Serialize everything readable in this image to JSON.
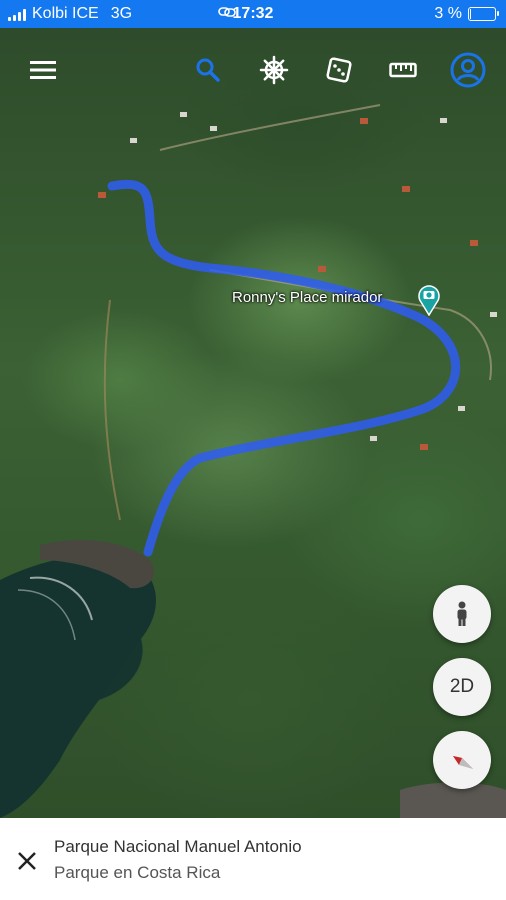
{
  "status_bar": {
    "carrier": "Kolbi ICE",
    "network": "3G",
    "time": "17:32",
    "battery": "3 %",
    "battery_level": 0.03
  },
  "toolbar": {
    "menu_icon": "hamburger-menu-icon",
    "search_icon": "search-icon",
    "voyager_icon": "ship-wheel-icon",
    "feeling_lucky_icon": "dice-icon",
    "measure_icon": "ruler-icon",
    "account_icon": "account-circle-icon"
  },
  "map": {
    "place_label": "Ronny's Place mirador",
    "place_icon": "camera-pin-icon",
    "path_color": "#2f5df5"
  },
  "map_controls": {
    "pegman_icon": "pegman-icon",
    "view_toggle_label": "2D",
    "compass_icon": "compass-icon"
  },
  "bottom_sheet": {
    "close_icon": "close-icon",
    "title": "Parque Nacional Manuel Antonio",
    "subtitle": "Parque en Costa Rica"
  },
  "colors": {
    "status_bar": "#1479f0",
    "accent": "#1a73e8",
    "pin": "#1aa3a3"
  }
}
